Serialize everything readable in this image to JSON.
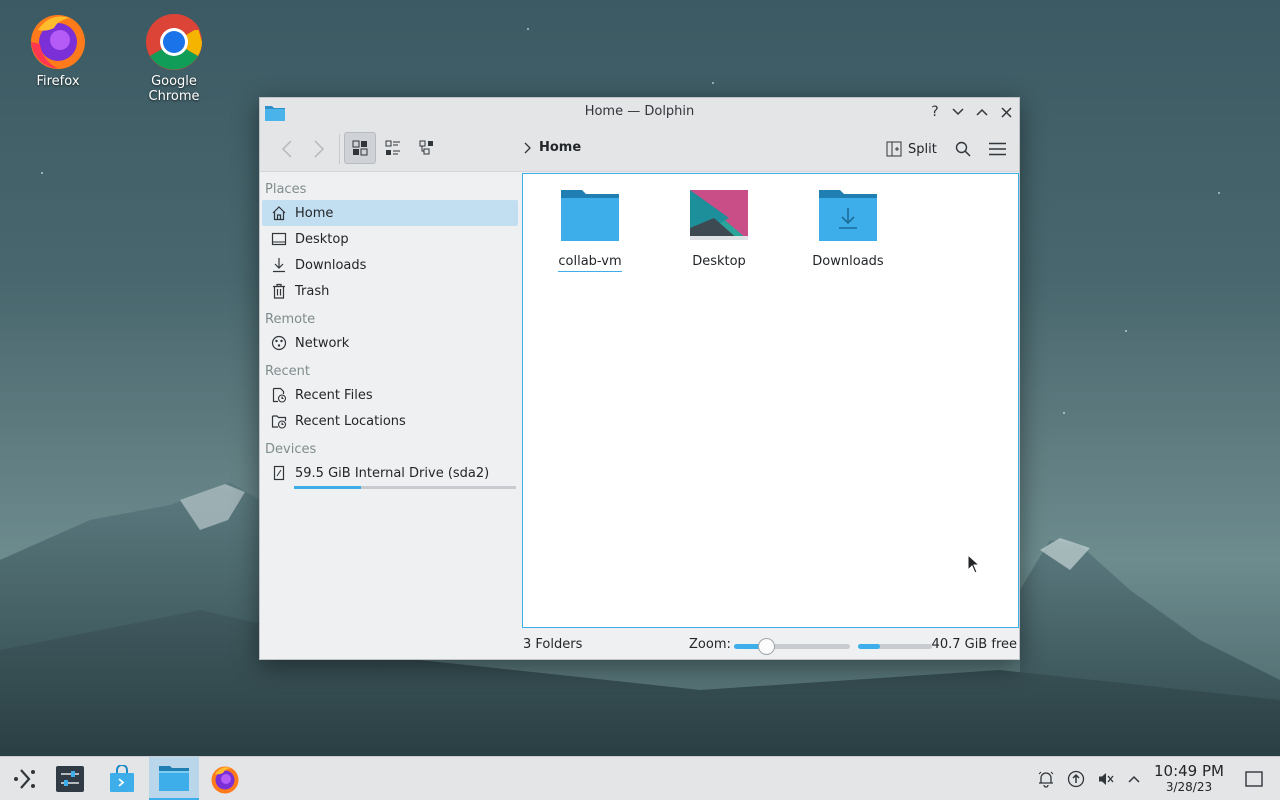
{
  "desktop": {
    "icons": [
      {
        "label": "Firefox"
      },
      {
        "label": "Google Chrome"
      }
    ]
  },
  "window": {
    "title": "Home — Dolphin",
    "buttons": {
      "help": "?",
      "minimize": "⌄",
      "maximize": "⌃",
      "close": "✕"
    }
  },
  "toolbar": {
    "breadcrumb": "Home",
    "split_label": "Split"
  },
  "sidebar": {
    "sections": {
      "places": "Places",
      "remote": "Remote",
      "recent": "Recent",
      "devices": "Devices"
    },
    "places": [
      {
        "label": "Home",
        "icon": "home-icon"
      },
      {
        "label": "Desktop",
        "icon": "desktop-icon"
      },
      {
        "label": "Downloads",
        "icon": "download-icon"
      },
      {
        "label": "Trash",
        "icon": "trash-icon"
      }
    ],
    "remote": [
      {
        "label": "Network",
        "icon": "network-icon"
      }
    ],
    "recent": [
      {
        "label": "Recent Files",
        "icon": "recent-files-icon"
      },
      {
        "label": "Recent Locations",
        "icon": "recent-locations-icon"
      }
    ],
    "devices": [
      {
        "label": "59.5 GiB Internal Drive (sda2)",
        "icon": "drive-icon",
        "usage_fraction": 0.3
      }
    ]
  },
  "content": {
    "items": [
      {
        "label": "collab-vm",
        "type": "folder"
      },
      {
        "label": "Desktop",
        "type": "desktop-folder"
      },
      {
        "label": "Downloads",
        "type": "downloads-folder"
      }
    ]
  },
  "statusbar": {
    "summary": "3 Folders",
    "zoom_label": "Zoom:",
    "zoom_fraction": 0.28,
    "free_text": "40.7 GiB free",
    "free_used_fraction": 0.3
  },
  "taskbar": {
    "time": "10:49 PM",
    "date": "3/28/23"
  },
  "colors": {
    "accent": "#3daee9",
    "selection": "#c2dff2",
    "window_bg": "#eff0f1",
    "taskbar_bg": "#e3e5e7"
  }
}
